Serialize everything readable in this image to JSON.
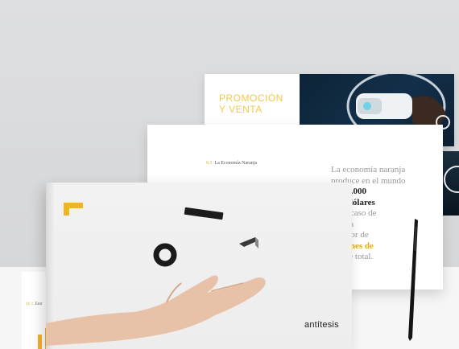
{
  "back_page": {
    "title_line1": "PROMOCIÓN",
    "title_line2": "Y VENTA"
  },
  "econ_page": {
    "section_number": "6.1",
    "section_title": "La Economía Naranja",
    "text_1": "La economía naranja",
    "text_2": "produce en el mundo",
    "text_3_value": "4.293.000",
    "text_4_bold": "s de dólares",
    "text_5": "en el caso de",
    "text_6": "Latina",
    "text_7": "rededor de",
    "text_8_highlight": "millones de",
    "text_9": "de ese total."
  },
  "chart_page": {
    "section_number": "11.1",
    "section_title": "Entr"
  },
  "book_cover": {
    "brand": "antítesis"
  },
  "colors": {
    "accent": "#f0b429",
    "background": "#dcdde0"
  }
}
